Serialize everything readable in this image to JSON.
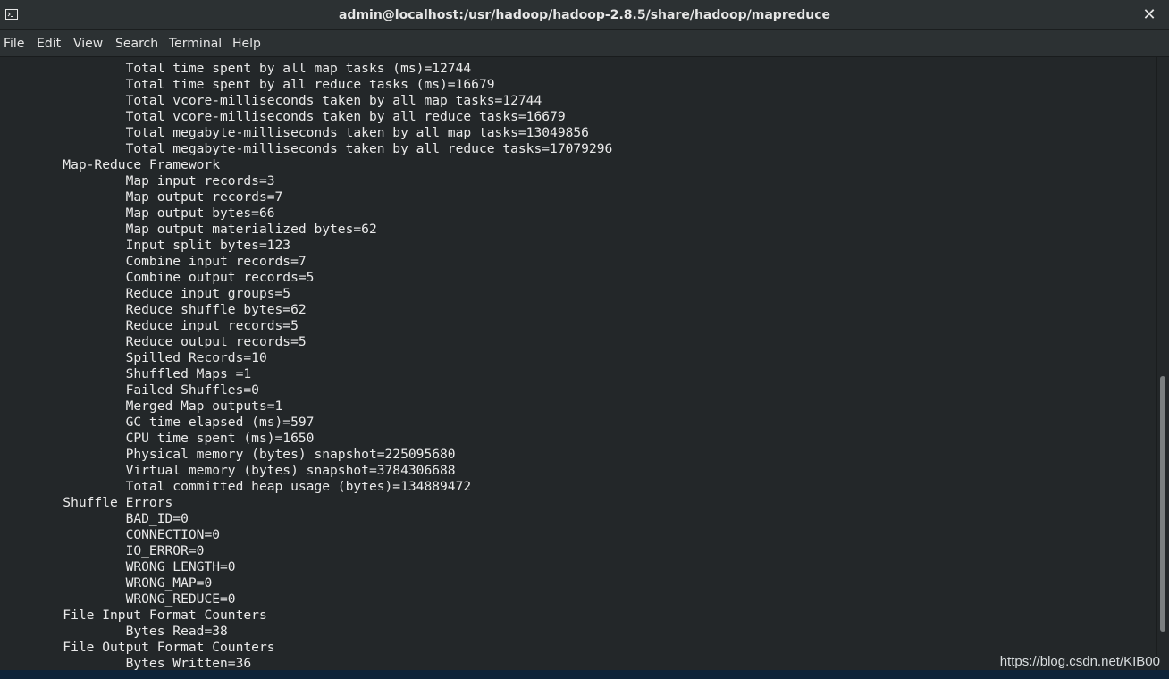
{
  "window": {
    "title": "admin@localhost:/usr/hadoop/hadoop-2.8.5/share/hadoop/mapreduce",
    "close_glyph": "✕",
    "icon": "terminal-icon"
  },
  "menu": [
    "File",
    "Edit",
    "View",
    "Search",
    "Terminal",
    "Help"
  ],
  "terminal_lines": [
    "                Total time spent by all map tasks (ms)=12744",
    "                Total time spent by all reduce tasks (ms)=16679",
    "                Total vcore-milliseconds taken by all map tasks=12744",
    "                Total vcore-milliseconds taken by all reduce tasks=16679",
    "                Total megabyte-milliseconds taken by all map tasks=13049856",
    "                Total megabyte-milliseconds taken by all reduce tasks=17079296",
    "        Map-Reduce Framework",
    "                Map input records=3",
    "                Map output records=7",
    "                Map output bytes=66",
    "                Map output materialized bytes=62",
    "                Input split bytes=123",
    "                Combine input records=7",
    "                Combine output records=5",
    "                Reduce input groups=5",
    "                Reduce shuffle bytes=62",
    "                Reduce input records=5",
    "                Reduce output records=5",
    "                Spilled Records=10",
    "                Shuffled Maps =1",
    "                Failed Shuffles=0",
    "                Merged Map outputs=1",
    "                GC time elapsed (ms)=597",
    "                CPU time spent (ms)=1650",
    "                Physical memory (bytes) snapshot=225095680",
    "                Virtual memory (bytes) snapshot=3784306688",
    "                Total committed heap usage (bytes)=134889472",
    "        Shuffle Errors",
    "                BAD_ID=0",
    "                CONNECTION=0",
    "                IO_ERROR=0",
    "                WRONG_LENGTH=0",
    "                WRONG_MAP=0",
    "                WRONG_REDUCE=0",
    "        File Input Format Counters",
    "                Bytes Read=38",
    "        File Output Format Counters",
    "                Bytes Written=36"
  ],
  "watermark": "https://blog.csdn.net/KIB00"
}
